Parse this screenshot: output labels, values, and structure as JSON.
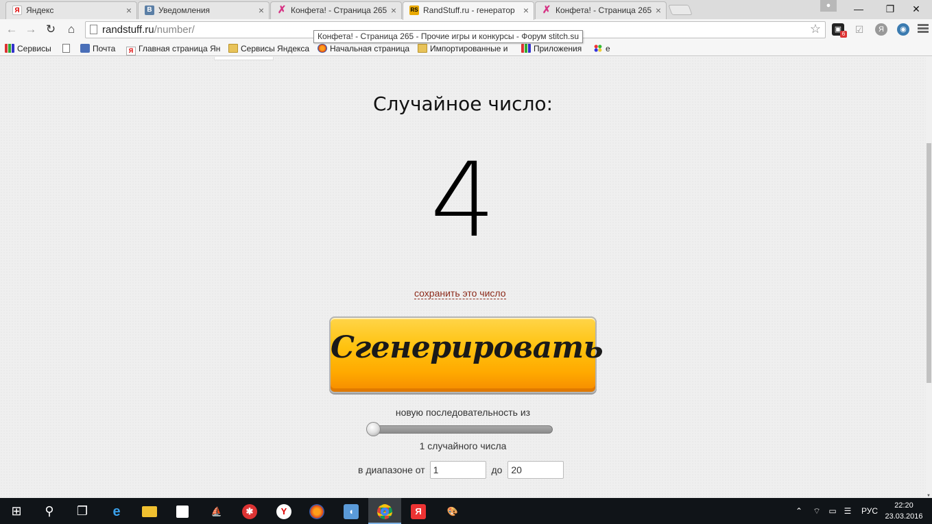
{
  "tabs": [
    {
      "title": "Яндекс",
      "favicon": "yandex-icon",
      "active": false
    },
    {
      "title": "Уведомления",
      "favicon": "vk-icon",
      "active": false
    },
    {
      "title": "Конфета! - Страница 265",
      "favicon": "konfeta-icon",
      "active": false
    },
    {
      "title": "RandStuff.ru - генератор",
      "favicon": "randstuff-icon",
      "active": true
    },
    {
      "title": "Конфета! - Страница 265",
      "favicon": "konfeta-icon",
      "active": false
    }
  ],
  "toolbar": {
    "url_host": "randstuff.ru",
    "url_path": "/number/"
  },
  "tooltip": "Конфета! - Страница 265 - Прочие игры и конкурсы - Форум stitch.su",
  "bookmarks": [
    {
      "label": "Сервисы",
      "icon": "apps-icon"
    },
    {
      "label": "",
      "icon": "document-icon"
    },
    {
      "label": "Почта",
      "icon": "mail-icon"
    },
    {
      "label": "Главная страница Ян",
      "icon": "yandex-icon"
    },
    {
      "label": "Сервисы Яндекса",
      "icon": "folder-icon"
    },
    {
      "label": "Начальная страница",
      "icon": "firefox-icon"
    },
    {
      "label": "Импортированные и",
      "icon": "folder-icon"
    },
    {
      "label": "Приложения",
      "icon": "apps-icon"
    },
    {
      "label": "е",
      "icon": "dots-icon"
    }
  ],
  "main": {
    "result_label": "Случайное число:",
    "result_value": "4",
    "save_link": "сохранить это число",
    "generate_button": "Сгенерировать",
    "sequence_label": "новую последовательность из",
    "count_label": "1 случайного числа",
    "slider_value": 1,
    "range_from_label": "в диапазоне от",
    "range_from_value": "1",
    "range_to_label": "до",
    "range_to_value": "20"
  },
  "taskbar": {
    "tray_lang": "РУС",
    "time": "22:20",
    "date": "23.03.2016"
  },
  "colors": {
    "button_gradient_top": "#ffd54a",
    "button_gradient_bottom": "#f58b00",
    "save_link": "#8c2a1a",
    "taskbar": "#101418"
  }
}
